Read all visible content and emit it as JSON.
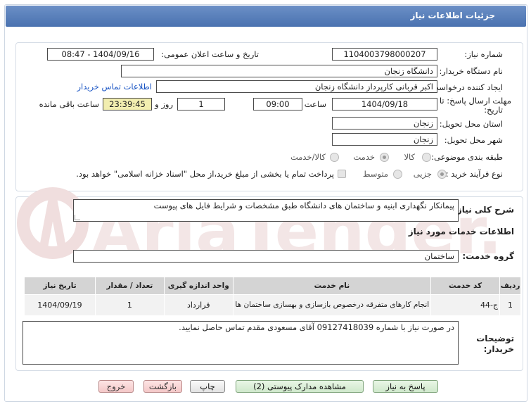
{
  "title": "جزئیات اطلاعات نیاز",
  "fields": {
    "need_number_label": "شماره نیاز:",
    "need_number": "1104003798000207",
    "announce_label": "تاریخ و ساعت اعلان عمومی:",
    "announce_value": "1404/09/16 - 08:47",
    "buyer_org_label": "نام دستگاه خریدار:",
    "buyer_org": "دانشگاه زنجان",
    "creator_label": "ایجاد کننده درخواست:",
    "creator": "اکبر قربانی کارپرداز دانشگاه زنجان",
    "contact_link": "اطلاعات تماس خریدار",
    "deadline_label_1": "مهلت ارسال پاسخ: تا",
    "deadline_label_2": "تاریخ:",
    "deadline_date": "1404/09/18",
    "time_label": "ساعت",
    "deadline_time": "09:00",
    "days_value": "1",
    "days_label": "روز و",
    "remaining_time": "23:39:45",
    "remaining_label": "ساعت باقی مانده",
    "province_label": "استان محل تحویل:",
    "province": "زنجان",
    "city_label": "شهر محل تحویل:",
    "city": "زنجان"
  },
  "category": {
    "label": "طبقه بندی موضوعی:",
    "options": [
      "کالا",
      "خدمت",
      "کالا/خدمت"
    ],
    "selected": "خدمت"
  },
  "process": {
    "label": "نوع فرآیند خرید :",
    "options": [
      "جزیی",
      "متوسط"
    ],
    "selected": "جزیی",
    "payment_note": "پرداخت تمام یا بخشی از مبلغ خرید،از محل \"اسناد خزانه اسلامی\" خواهد بود."
  },
  "summary": {
    "label": "شرح کلی نیاز:",
    "text": "پیمانکار نگهداری ابنیه و ساختمان های دانشگاه طبق مشخصات و شرایط فایل های پیوست"
  },
  "services_heading": "اطلاعات خدمات مورد نیاز",
  "service_group_label": "گروه خدمت:",
  "service_group": "ساختمان",
  "table": {
    "headers": [
      "ردیف",
      "کد خدمت",
      "نام خدمت",
      "واحد اندازه گیری",
      "تعداد / مقدار",
      "تاریخ نیاز"
    ],
    "rows": [
      [
        "1",
        "ج-44",
        "انجام کارهای متفرقه درخصوص بازسازی و بهسازی ساختمان ها",
        "قرارداد",
        "1",
        "1404/09/19"
      ]
    ]
  },
  "notes": {
    "label_1": "توضیحات",
    "label_2": "خریدار:",
    "text": "در صورت نیاز با شماره 09127418039 آقای مسعودی مقدم تماس حاصل نمایید."
  },
  "buttons": {
    "reply": "پاسخ به نیاز",
    "view_docs": "مشاهده مدارک پیوستی (2)",
    "print": "چاپ",
    "back": "بازگشت",
    "exit": "خروج"
  },
  "watermark": "AriaTender.net",
  "colors": {
    "title_bar": "#4a72b0",
    "yellow_timer": "#f2eeb0",
    "link": "#1a55c4",
    "watermark": "#f0dede"
  }
}
